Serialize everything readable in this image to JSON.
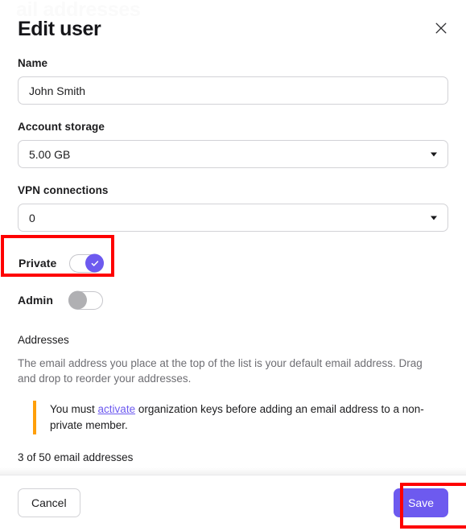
{
  "ghost_artifact": "ail addresses",
  "header": {
    "title": "Edit user",
    "close_icon": "close-icon"
  },
  "fields": {
    "name": {
      "label": "Name",
      "value": "John Smith",
      "placeholder": "Name"
    },
    "account_storage": {
      "label": "Account storage",
      "value": "5.00 GB"
    },
    "vpn_connections": {
      "label": "VPN connections",
      "value": "0"
    }
  },
  "toggles": {
    "private": {
      "label": "Private",
      "state": "on",
      "icon": "check-icon"
    },
    "admin": {
      "label": "Admin",
      "state": "off"
    }
  },
  "addresses": {
    "title": "Addresses",
    "description": "The email address you place at the top of the list is your default email address. Drag and drop to reorder your addresses.",
    "notice": {
      "text_before": "You must ",
      "link": "activate",
      "text_after": " organization keys before adding an email address to a non-private member.",
      "accent_color": "#ff9f0a"
    },
    "count": "3 of 50 email addresses"
  },
  "footer": {
    "cancel_label": "Cancel",
    "save_label": "Save"
  },
  "colors": {
    "accent_purple": "#6d5aef",
    "notice_orange": "#ff9f0a",
    "highlight_red": "#fe0000",
    "border_gray": "#d2d2d6",
    "muted_text": "#6e6e73"
  },
  "annotations": [
    {
      "name": "private-toggle-highlight",
      "target": "private-toggle-row"
    },
    {
      "name": "save-button-highlight",
      "target": "save-button"
    }
  ]
}
